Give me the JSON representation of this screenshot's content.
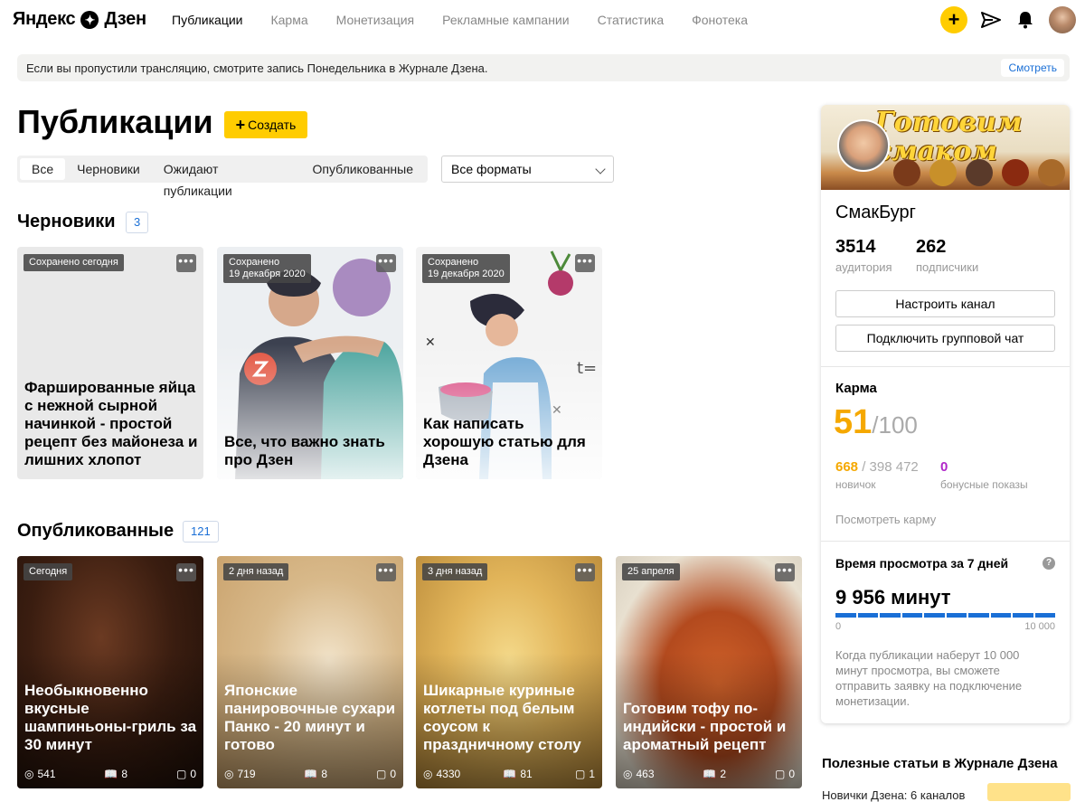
{
  "header": {
    "logo": "Яндекс",
    "logo_suffix": "Дзен",
    "nav": [
      "Публикации",
      "Карма",
      "Монетизация",
      "Рекламные кампании",
      "Статистика",
      "Фонотека"
    ],
    "plus": "+"
  },
  "banner": {
    "text": "Если вы пропустили трансляцию, смотрите запись Понедельника в Журнале Дзена.",
    "button": "Смотреть"
  },
  "page": {
    "title": "Публикации",
    "create": "Создать",
    "tabs": [
      "Все",
      "Черновики",
      "Ожидают публикации",
      "Опубликованные"
    ],
    "format_select": "Все форматы"
  },
  "drafts": {
    "title": "Черновики",
    "count": "3",
    "cards": [
      {
        "badge": "Сохранено сегодня",
        "title": "Фаршированные яйца с нежной сырной начинкой - простой рецепт без майонеза и лишних хлопот"
      },
      {
        "badge": "Сохранено\n19 декабря 2020",
        "title": "Все, что важно знать про Дзен"
      },
      {
        "badge": "Сохранено\n19 декабря 2020",
        "title": "Как написать хорошую статью для Дзена"
      }
    ]
  },
  "published": {
    "title": "Опубликованные",
    "count": "121",
    "cards": [
      {
        "badge": "Сегодня",
        "title": "Необыкновенно вкусные шампиньоны-гриль за 30 минут",
        "views": "541",
        "reads": "8",
        "comments": "0"
      },
      {
        "badge": "2 дня назад",
        "title": "Японские панировочные сухари Панко - 20 минут и готово",
        "views": "719",
        "reads": "8",
        "comments": "0"
      },
      {
        "badge": "3 дня назад",
        "title": "Шикарные куриные котлеты под белым соусом к праздничному столу",
        "views": "4330",
        "reads": "81",
        "comments": "1"
      },
      {
        "badge": "25 апреля",
        "title": "Готовим тофу по-индийски - простой и ароматный рецепт",
        "views": "463",
        "reads": "2",
        "comments": "0"
      }
    ]
  },
  "sidebar": {
    "cover_text": "Готовим смаком",
    "channel_name": "СмакБург",
    "audience": "3514",
    "audience_label": "аудитория",
    "subscribers": "262",
    "subscribers_label": "подписчики",
    "btn_settings": "Настроить канал",
    "btn_chat": "Подключить групповой чат",
    "karma_title": "Карма",
    "karma_value": "51",
    "karma_max": "/100",
    "karma_current": "668",
    "karma_total": " / 398 472",
    "karma_level": "новичок",
    "bonus_value": "0",
    "bonus_label": "бонусные показы",
    "karma_link": "Посмотреть карму",
    "watch_title": "Время просмотра за 7 дней",
    "help": "?",
    "minutes": "9 956 минут",
    "bar_min": "0",
    "bar_max": "10 000",
    "progress": 0.9956,
    "note": "Когда публикации наберут 10 000 минут просмотра, вы сможете отправить заявку на подключение монетизации."
  },
  "useful": {
    "title": "Полезные статьи в Журнале Дзена",
    "first_item": "Новички Дзена: 6 каналов"
  },
  "colors": {
    "accent": "#ffcc00",
    "link": "#1a6fd6",
    "karma": "#f5a800",
    "bonus": "#b026c9"
  }
}
